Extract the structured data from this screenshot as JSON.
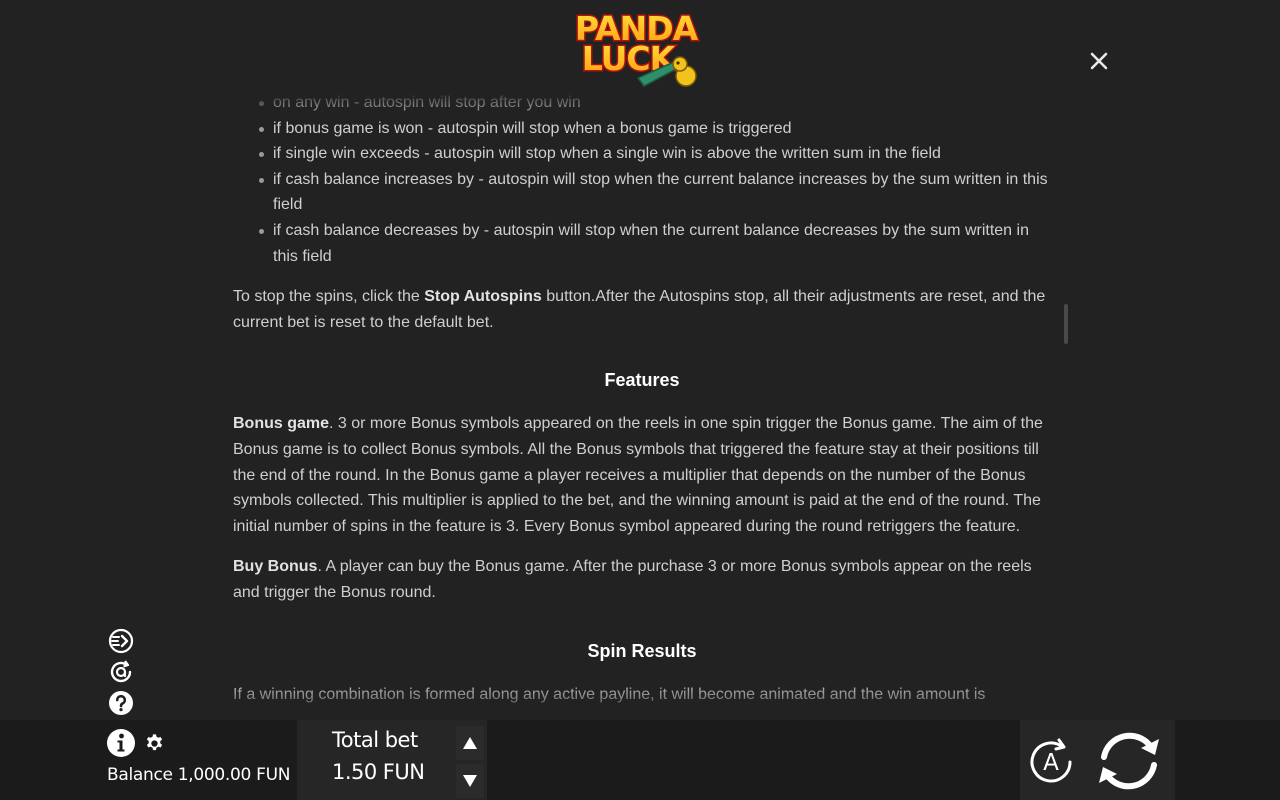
{
  "brand": {
    "logo_line1": "PANDA",
    "logo_line2": "LUCK"
  },
  "rules": {
    "autospin_stops": [
      "on any win - autospin will stop after you win",
      "if bonus game is won - autospin will stop when a bonus game is triggered",
      "if single win exceeds - autospin will stop when a single win is above the written sum in the field",
      "if cash balance increases by - autospin will stop when the current balance increases by the sum written in this field",
      "if cash balance decreases by - autospin will stop when the current balance decreases by the sum written in this field"
    ],
    "stop_para": {
      "before": "To stop the spins, click the ",
      "bold": "Stop Autospins",
      "after": " button.After the Autospins stop, all their adjustments are reset, and the current bet is reset to the default bet."
    },
    "features_heading": "Features",
    "bonus_game": {
      "bold": "Bonus game",
      "text": ". 3 or more Bonus symbols appeared on the reels in one spin trigger the Bonus game. The aim of the Bonus game is to collect Bonus symbols. All the Bonus symbols that triggered the feature stay at their positions till the end of the round. In the Bonus game a player receives a multiplier that depends on the number of the Bonus symbols collected. This multiplier is applied to the bet, and the winning amount is paid at the end of the round. The initial number of spins in the feature is 3. Every Bonus symbol appeared during the round retriggers the feature."
    },
    "buy_bonus": {
      "bold": "Buy Bonus",
      "text": ". A player can buy the Bonus game. After the purchase 3 or more Bonus symbols appear on the reels and trigger the Bonus round."
    },
    "spin_results_heading": "Spin Results",
    "spin_results_text": "If a winning combination is formed along any active payline, it will become animated and the win amount is"
  },
  "footer": {
    "balance_label": "Balance",
    "balance_value": "1,000.00 FUN",
    "total_bet_label": "Total bet",
    "total_bet_value": "1.50",
    "total_bet_currency": "FUN",
    "auto_label": "A"
  },
  "icons": {
    "close": "close-icon",
    "turbo": "turbo-icon",
    "auto_refresh": "autoplay-history-icon",
    "help": "help-icon",
    "info": "info-icon",
    "settings": "gear-icon",
    "bet_up": "arrow-up-icon",
    "bet_down": "arrow-down-icon",
    "autospin": "autospin-icon",
    "spin": "spin-icon"
  },
  "colors": {
    "background": "#222222",
    "text": "#cfcfcf",
    "heading": "#ffffff",
    "logo_red": "#e0221b",
    "logo_yellow": "#ffd21a"
  }
}
